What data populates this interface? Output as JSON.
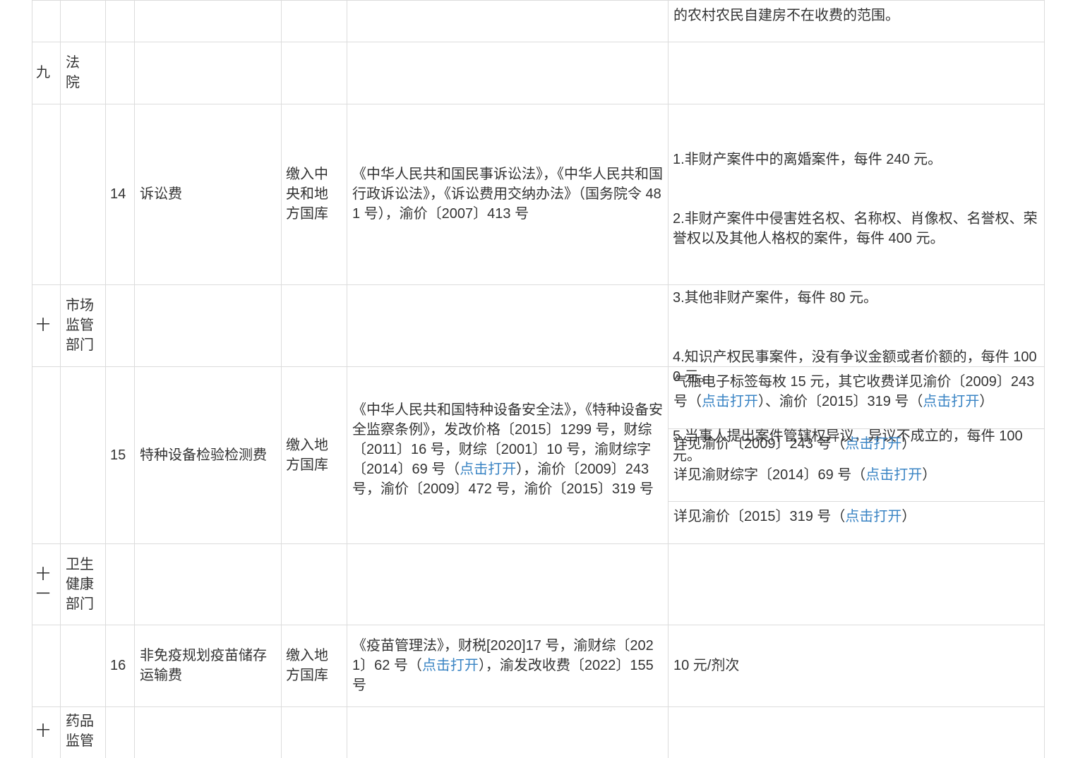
{
  "colors": {
    "grid": "#dcdcdc",
    "text": "#333333",
    "link": "#3a84c4"
  },
  "rows": {
    "r0": {
      "desc": "的农村农民自建房不在收费的范围。"
    },
    "r9": {
      "seq": "九",
      "dept": "法\n院"
    },
    "r14": {
      "no": "14",
      "name": "诉讼费",
      "dest": "缴入中\n央和地\n方国库",
      "basis": "《中华人民共和国民事诉讼法》，《中华人民共和国行政诉讼法》，《诉讼费用交纳办法》（国务院令 481 号），渝价〔2007〕413 号",
      "desc": [
        "1.非财产案件中的离婚案件，每件 240 元。",
        "2.非财产案件中侵害姓名权、名称权、肖像权、名誉权、荣誉权以及其他人格权的案件，每件 400 元。",
        "3.其他非财产案件，每件 80 元。",
        "4.知识产权民事案件，没有争议金额或者价额的，每件 1000 元。",
        "5.当事人提出案件管辖权异议，异议不成立的，每件 100 元。"
      ]
    },
    "r10": {
      "seq": "十",
      "dept": "市场\n监管\n部门"
    },
    "r15": {
      "no": "15",
      "name": "特种设备检验检测费",
      "dest": "缴入地\n方国库",
      "basis_a": "《中华人民共和国特种设备安全法》，《特种设备安全监察条例》，发改价格〔2015〕1299 号，财综〔2011〕16 号，财综〔2001〕10 号，渝财综字〔2014〕69 号（",
      "basis_link": "点击打开",
      "basis_b": "），渝价〔2009〕243 号，渝价〔2009〕472 号，渝价〔2015〕319 号",
      "sub1_a": "气瓶电子标签每枚 15 元，其它收费详见渝价〔2009〕243 号（",
      "sub1_link1": "点击打开",
      "sub1_b": "）、渝价〔2015〕319 号（",
      "sub1_link2": "点击打开",
      "sub1_c": "）",
      "sub2_a": "详见渝价〔2009〕243 号（",
      "sub2_link": "点击打开",
      "sub2_b": "）",
      "sub3_a": "详见渝财综字〔2014〕69 号（",
      "sub3_link": "点击打开",
      "sub3_b": "）",
      "sub4_a": "详见渝价〔2015〕319 号（",
      "sub4_link": "点击打开",
      "sub4_b": "）"
    },
    "r11": {
      "seq": "十\n一",
      "dept": "卫生\n健康\n部门"
    },
    "r16": {
      "no": "16",
      "name": "非免疫规划疫苗储存运输费",
      "dest": "缴入地\n方国库",
      "basis_a": "《疫苗管理法》，财税[2020]17 号，渝财综〔2021〕62 号（",
      "basis_link": "点击打开",
      "basis_b": "），渝发改收费〔2022〕155 号",
      "desc": "10 元/剂次"
    },
    "r12": {
      "seq": "十",
      "dept": "药品\n监管"
    }
  }
}
